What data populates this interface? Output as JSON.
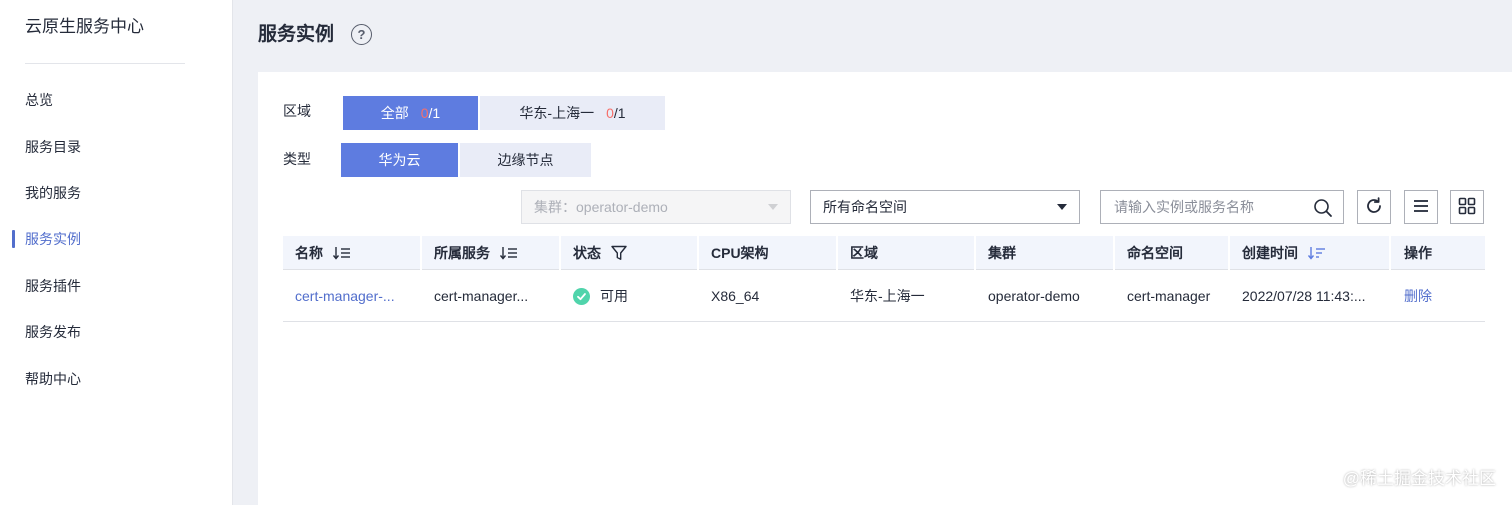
{
  "sidebar": {
    "title": "云原生服务中心",
    "items": [
      {
        "label": "总览"
      },
      {
        "label": "服务目录"
      },
      {
        "label": "我的服务"
      },
      {
        "label": "服务实例"
      },
      {
        "label": "服务插件"
      },
      {
        "label": "服务发布"
      },
      {
        "label": "帮助中心"
      }
    ],
    "active_item": "服务实例"
  },
  "header": {
    "title": "服务实例",
    "help_icon": "question-circle-icon"
  },
  "filters": {
    "region_label": "区域",
    "region_tabs": [
      {
        "label": "全部",
        "count_red": "0",
        "count_rest": "/1",
        "selected": true
      },
      {
        "label": "华东-上海一",
        "count_red": "0",
        "count_rest": "/1",
        "selected": false
      }
    ],
    "type_label": "类型",
    "type_tabs": [
      {
        "label": "华为云",
        "selected": true
      },
      {
        "label": "边缘节点",
        "selected": false
      }
    ]
  },
  "toolbar": {
    "cluster_select": "集群：operator-demo",
    "namespace_select": "所有命名空间",
    "search_placeholder": "请输入实例或服务名称",
    "icons": [
      "refresh-icon",
      "list-view-icon",
      "grid-view-icon"
    ]
  },
  "table": {
    "columns": [
      "名称",
      "所属服务",
      "状态",
      "CPU架构",
      "区域",
      "集群",
      "命名空间",
      "创建时间",
      "操作"
    ],
    "rows": [
      {
        "name": "cert-manager-...",
        "service": "cert-manager...",
        "status": "可用",
        "cpu_arch": "X86_64",
        "region": "华东-上海一",
        "cluster": "operator-demo",
        "namespace": "cert-manager",
        "created": "2022/07/28 11:43:...",
        "action": "删除"
      }
    ]
  },
  "watermark": "@稀土掘金技术社区",
  "colors": {
    "accent": "#5e7ce0",
    "link": "#526ecc",
    "status_ok": "#50d4ab",
    "count_red": "#f66f6a"
  }
}
